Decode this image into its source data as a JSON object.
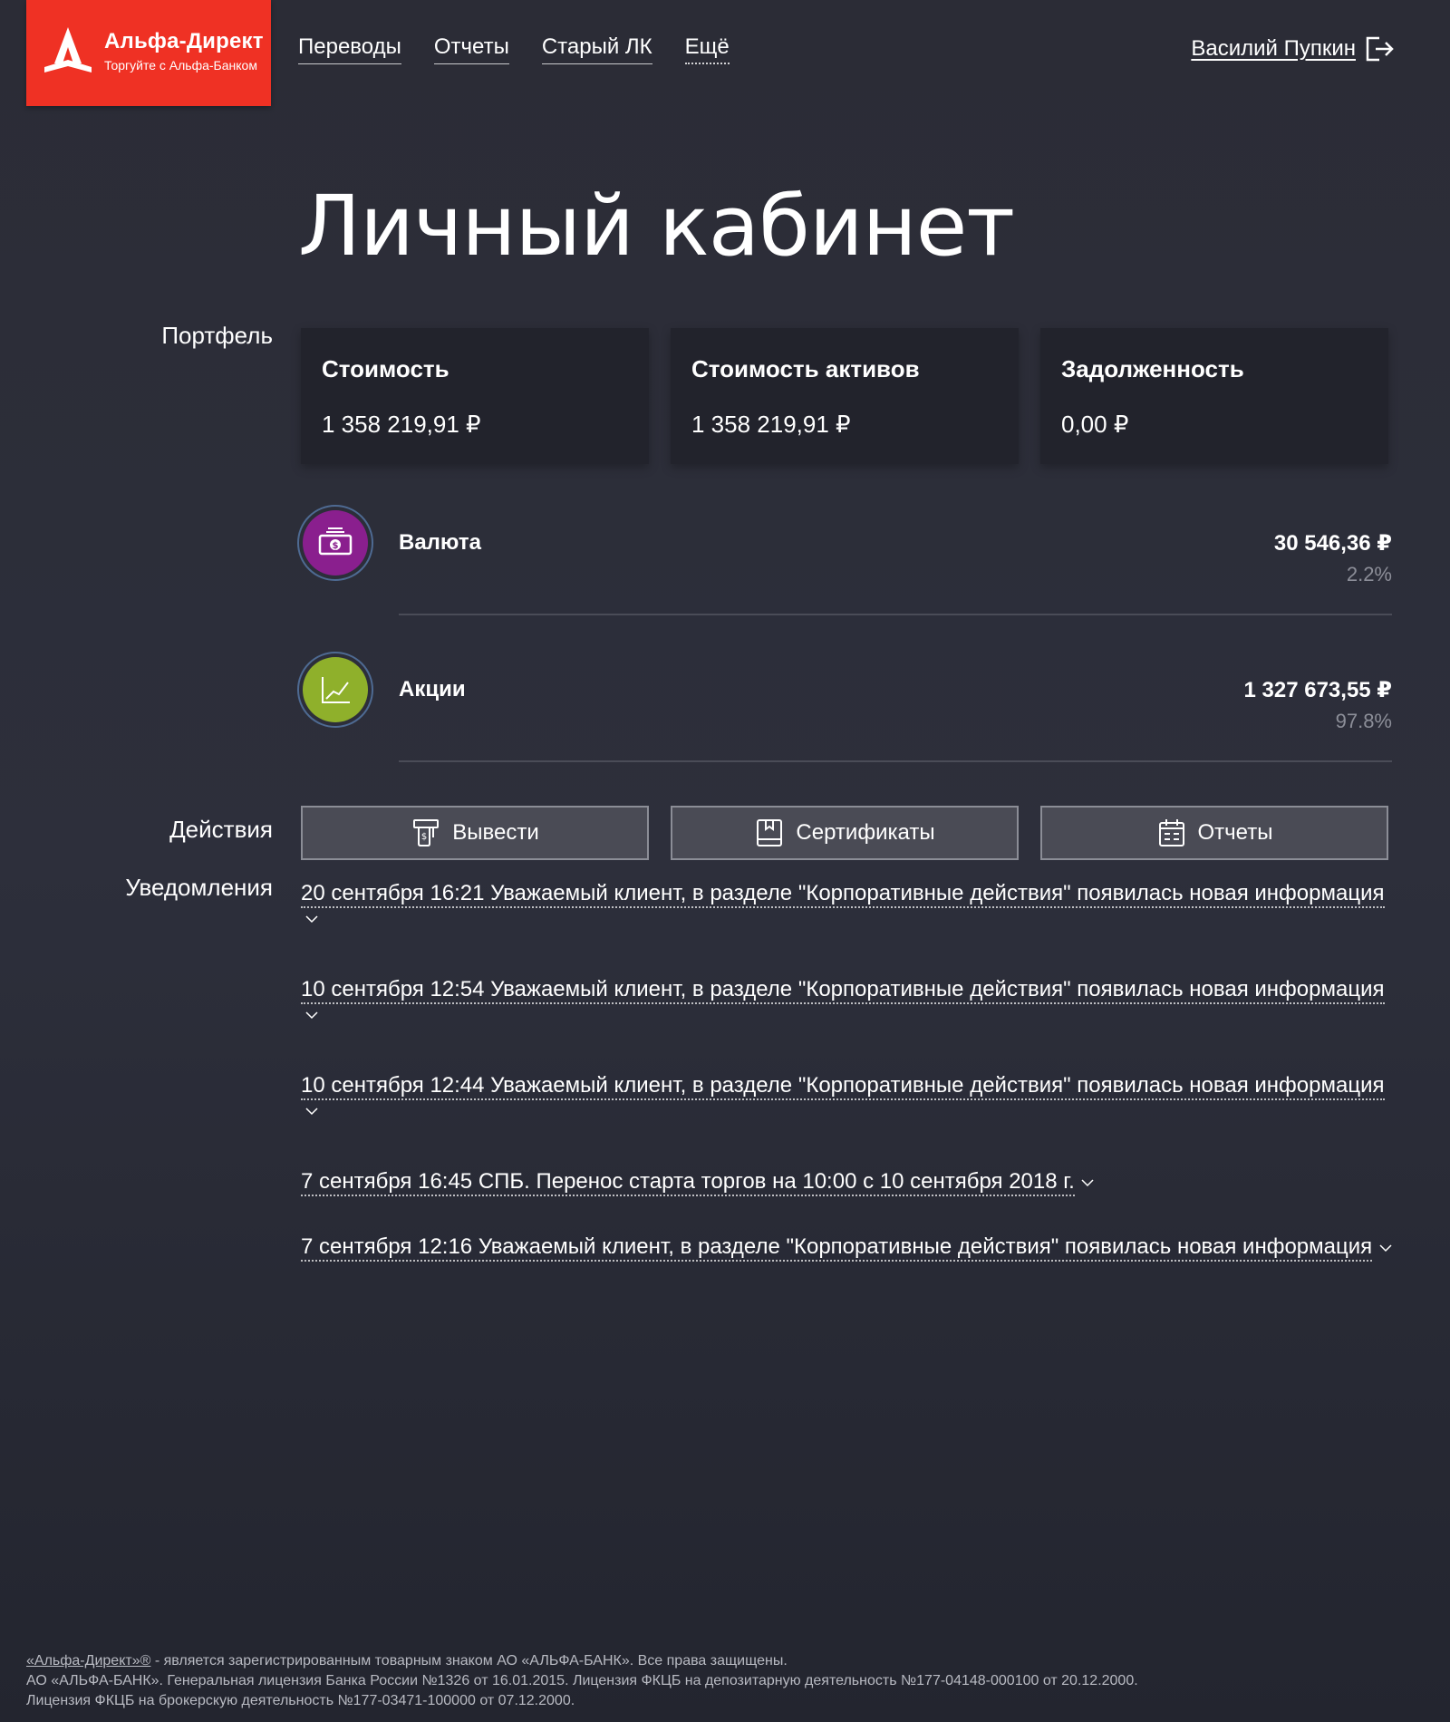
{
  "colors": {
    "brand": "#ef3124",
    "card_bg": "#22232c",
    "currency_circle": "#8a1f8e",
    "stocks_circle": "#8fb02b",
    "button_bg": "#4a4b55"
  },
  "logo": {
    "title": "Альфа-Директ",
    "subtitle": "Торгуйте с Альфа-Банком"
  },
  "nav": {
    "items": [
      "Переводы",
      "Отчеты",
      "Старый ЛК",
      "Ещё"
    ]
  },
  "user": {
    "name": "Василий Пупкин",
    "logout_icon": "logout-icon"
  },
  "page_title": "Личный кабинет",
  "portfolio": {
    "label": "Портфель",
    "cards": [
      {
        "title": "Стоимость",
        "value": "1 358 219,91 ₽"
      },
      {
        "title": "Стоимость активов",
        "value": "1 358 219,91 ₽"
      },
      {
        "title": "Задолженность",
        "value": "0,00 ₽"
      }
    ],
    "assets": [
      {
        "name": "Валюта",
        "value": "30 546,36 ₽",
        "percent": "2.2%",
        "icon": "banknote-icon"
      },
      {
        "name": "Акции",
        "value": "1 327 673,55 ₽",
        "percent": "97.8%",
        "icon": "chart-line-icon"
      }
    ]
  },
  "actions": {
    "label": "Действия",
    "buttons": [
      {
        "label": "Вывести",
        "icon": "withdraw-icon"
      },
      {
        "label": "Сертификаты",
        "icon": "certificate-icon"
      },
      {
        "label": "Отчеты",
        "icon": "calendar-icon"
      }
    ]
  },
  "notifications": {
    "label": "Уведомления",
    "items": [
      "20 сентября 16:21 Уважаемый клиент, в разделе \"Корпоративные действия\" появилась новая информация",
      "10 сентября 12:54 Уважаемый клиент, в разделе \"Корпоративные действия\" появилась новая информация",
      "10 сентября 12:44 Уважаемый клиент, в разделе \"Корпоративные действия\" появилась новая информация",
      "7 сентября 16:45 СПБ. Перенос старта торгов на 10:00 с 10 сентября 2018 г.",
      "7 сентября 12:16 Уважаемый клиент, в разделе \"Корпоративные действия\" появилась новая информация"
    ]
  },
  "footer": {
    "trademark_link": "«Альфа-Директ»®",
    "line1_rest": " - является зарегистрированным товарным знаком АО «АЛЬФА-БАНК». Все права защищены.",
    "line2": "АО «АЛЬФА-БАНК». Генеральная лицензия Банка России №1326 от 16.01.2015. Лицензия ФКЦБ на депозитарную деятельность №177-04148-000100 от 20.12.2000.",
    "line3": "Лицензия ФКЦБ на брокерскую деятельность №177-03471-100000 от 07.12.2000."
  }
}
